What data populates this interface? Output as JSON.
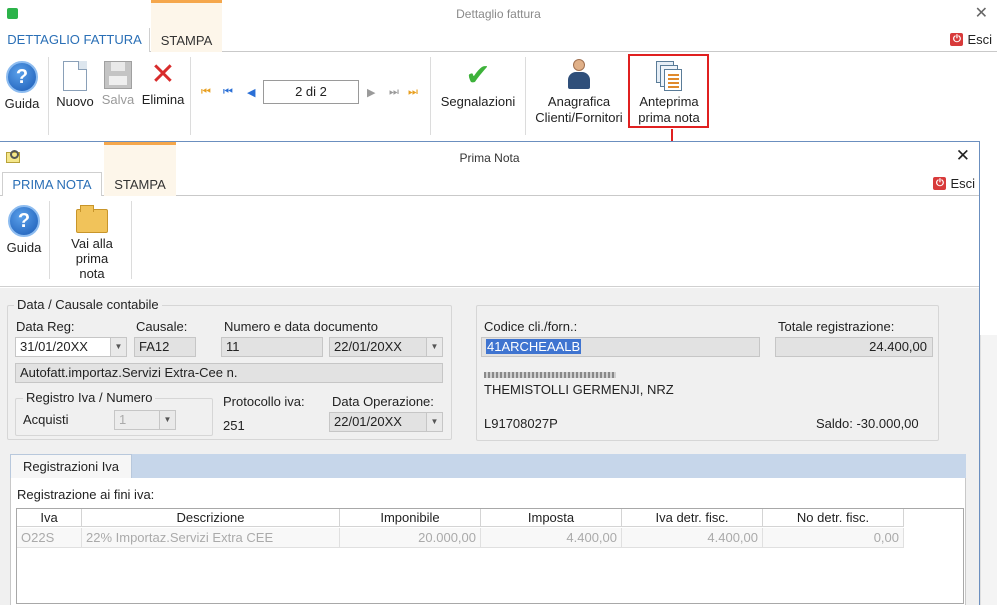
{
  "outer": {
    "title": "Dettaglio fattura",
    "tab_active": "DETTAGLIO FATTURA",
    "tab_stampa": "STAMPA",
    "esci": "Esci",
    "toolbar": {
      "guida": "Guida",
      "nuovo": "Nuovo",
      "salva": "Salva",
      "elimina": "Elimina",
      "nav_position": "2 di 2",
      "segnalazioni": "Segnalazioni",
      "anagrafica_line1": "Anagrafica",
      "anagrafica_line2": "Clienti/Fornitori",
      "anteprima_line1": "Anteprima",
      "anteprima_line2": "prima nota"
    }
  },
  "inner": {
    "title": "Prima Nota",
    "tab_active": "PRIMA NOTA",
    "tab_stampa": "STAMPA",
    "esci": "Esci",
    "toolbar": {
      "guida": "Guida",
      "vai_line1": "Vai alla",
      "vai_line2": "prima nota"
    },
    "causale_group": {
      "legend": "Data / Causale contabile",
      "data_reg_label": "Data Reg:",
      "data_reg_value": "31/01/20XX",
      "causale_label": "Causale:",
      "causale_value": "FA12",
      "numero_label": "Numero e data documento",
      "numero_value": "11",
      "data_doc_value": "22/01/20XX",
      "descrizione": "Autofatt.importaz.Servizi Extra-Cee n.",
      "registro_legend": "Registro Iva / Numero",
      "registro_value": "Acquisti",
      "registro_num": "1",
      "protocollo_label": "Protocollo iva:",
      "protocollo_value": "251",
      "data_op_label": "Data Operazione:",
      "data_op_value": "22/01/20XX"
    },
    "cliente_group": {
      "codice_label": "Codice cli./forn.:",
      "codice_value": "41ARCHEAALB",
      "totale_label": "Totale registrazione:",
      "totale_value": "24.400,00",
      "ragione_sociale": "THEMISTOLLI GERMENJI, NRZ",
      "codice_fiscale": "L91708027P",
      "saldo": "Saldo: -30.000,00"
    },
    "iva": {
      "tab": "Registrazioni Iva",
      "section_label": "Registrazione ai fini iva:",
      "columns": [
        "Iva",
        "Descrizione",
        "Imponibile",
        "Imposta",
        "Iva detr. fisc.",
        "No detr. fisc."
      ],
      "rows": [
        [
          "O22S",
          "22% Importaz.Servizi Extra CEE",
          "20.000,00",
          "4.400,00",
          "4.400,00",
          "0,00"
        ]
      ]
    }
  }
}
